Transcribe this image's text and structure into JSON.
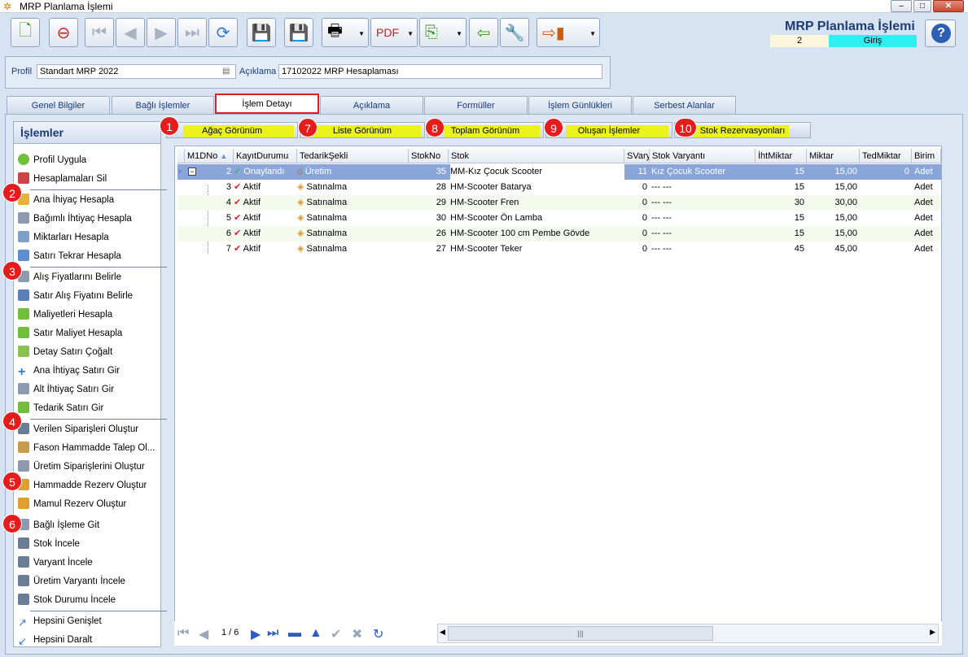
{
  "window": {
    "title": "MRP Planlama İşlemi",
    "min": "‒",
    "max": "□",
    "close": "✕"
  },
  "header": {
    "title": "MRP Planlama İşlemi",
    "number": "2",
    "mode": "Giriş",
    "help": "?"
  },
  "profile": {
    "profil_label": "Profil",
    "profil_value": "Standart MRP 2022",
    "aciklama_label": "Açıklama",
    "aciklama_value": "17102022 MRP Hesaplaması"
  },
  "tabs": [
    "Genel Bilgiler",
    "Bağlı İşlemler",
    "İşlem Detayı",
    "Açıklama",
    "Formüller",
    "İşlem Günlükleri",
    "Serbest Alanlar"
  ],
  "sidebar": {
    "title": "İşlemler",
    "items": [
      "Profil Uygula",
      "Hesaplamaları Sil",
      "Ana İhiyaç Hesapla",
      "Bağımlı İhtiyaç Hesapla",
      "Miktarları Hesapla",
      "Satırı Tekrar Hesapla",
      "Alış Fiyatlarını Belirle",
      "Satır Alış Fiyatını Belirle",
      "Maliyetleri Hesapla",
      "Satır Maliyet Hesapla",
      "Detay Satırı Çoğalt",
      "Ana İhtiyaç Satırı Gir",
      "Alt İhtiyaç Satırı Gir",
      "Tedarik Satırı Gir",
      "Verilen Siparişleri Oluştur",
      "Fason Hammadde Talep Ol...",
      "Üretim Siparişlerini Oluştur",
      "Hammadde Rezerv Oluştur",
      "Mamul Rezerv Oluştur",
      "Bağlı İşleme Git",
      "Stok İncele",
      "Varyant İncele",
      "Üretim Varyantı İncele",
      "Stok Durumu İncele",
      "Hepsini Genişlet",
      "Hepsini Daralt"
    ]
  },
  "badges": [
    "1",
    "2",
    "3",
    "4",
    "5",
    "6",
    "7",
    "8",
    "9",
    "10"
  ],
  "subtabs": [
    "Ağaç Görünüm",
    "Liste Görünüm",
    "Toplam Görünüm",
    "Oluşan İşlemler",
    "Stok Rezervasyonları"
  ],
  "grid": {
    "columns": [
      "M1DNo",
      "KayıtDurumu",
      "TedarikŞekli",
      "StokNo",
      "Stok",
      "SVary",
      "Stok Varyantı",
      "İhtMiktar",
      "Miktar",
      "TedMiktar",
      "Birim"
    ],
    "rows": [
      [
        "2",
        "Onaylandı",
        "Üretim",
        "35",
        "MM-Kız Çocuk Scooter",
        "11",
        "Kız Çocuk Scooter",
        "15",
        "15,00",
        "0",
        "Adet"
      ],
      [
        "3",
        "Aktif",
        "Satınalma",
        "28",
        "HM-Scooter Batarya",
        "0",
        "--- ---",
        "15",
        "15,00",
        "",
        "Adet"
      ],
      [
        "4",
        "Aktif",
        "Satınalma",
        "29",
        "HM-Scooter Fren",
        "0",
        "--- ---",
        "30",
        "30,00",
        "",
        "Adet"
      ],
      [
        "5",
        "Aktif",
        "Satınalma",
        "30",
        "HM-Scooter Ön Lamba",
        "0",
        "--- ---",
        "15",
        "15,00",
        "",
        "Adet"
      ],
      [
        "6",
        "Aktif",
        "Satınalma",
        "26",
        "HM-Scooter 100 cm Pembe Gövde",
        "0",
        "--- ---",
        "15",
        "15,00",
        "",
        "Adet"
      ],
      [
        "7",
        "Aktif",
        "Satınalma",
        "27",
        "HM-Scooter Teker",
        "0",
        "--- ---",
        "45",
        "45,00",
        "",
        "Adet"
      ]
    ]
  },
  "navigator": {
    "page": "1 / 6",
    "scroll_grip": "|||"
  },
  "colors": {
    "highlight": "#ecf21c",
    "badge": "#e51c1c",
    "selected_row": "#8aa6d8",
    "mode_bg": "#2df0f0"
  }
}
